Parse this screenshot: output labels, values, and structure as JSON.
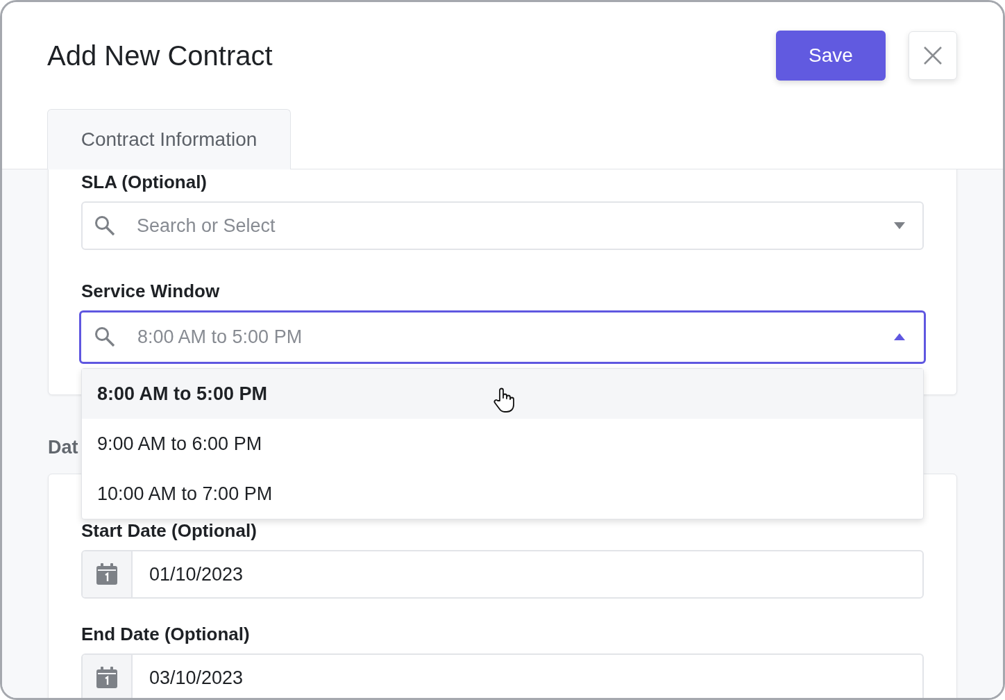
{
  "header": {
    "title": "Add New Contract",
    "save_button": "Save"
  },
  "tabs": [
    {
      "label": "Contract Information",
      "selected": true
    }
  ],
  "sla": {
    "label": "SLA (Optional)",
    "placeholder": "Search or Select"
  },
  "service_window": {
    "label": "Service Window",
    "placeholder": "8:00 AM to 5:00 PM",
    "expanded": true,
    "options": [
      {
        "label": "8:00 AM to 5:00 PM",
        "selected": true
      },
      {
        "label": "9:00 AM to 6:00 PM",
        "selected": false
      },
      {
        "label": "10:00 AM to 7:00 PM",
        "selected": false
      }
    ]
  },
  "dates_heading": "Dat",
  "start_date": {
    "label": "Start Date (Optional)",
    "value": "01/10/2023"
  },
  "end_date": {
    "label": "End Date (Optional)",
    "value": "03/10/2023"
  }
}
